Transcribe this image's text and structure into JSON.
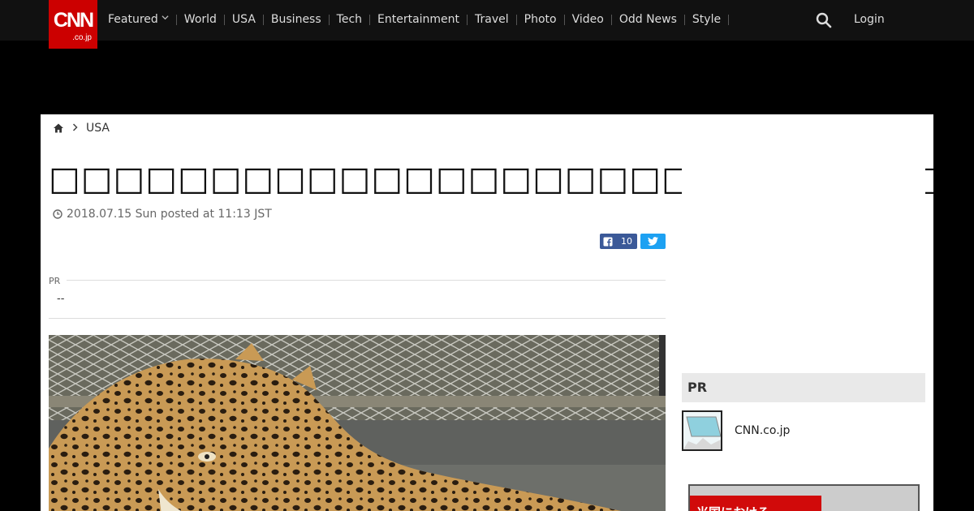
{
  "header": {
    "logo_main": "CNN",
    "logo_sub": ".co.jp",
    "nav": [
      {
        "label": "Featured",
        "has_dropdown": true
      },
      {
        "label": "World"
      },
      {
        "label": "USA"
      },
      {
        "label": "Business"
      },
      {
        "label": "Tech"
      },
      {
        "label": "Entertainment"
      },
      {
        "label": "Travel"
      },
      {
        "label": "Photo"
      },
      {
        "label": "Video"
      },
      {
        "label": "Odd News"
      },
      {
        "label": "Style"
      }
    ],
    "search_icon": "search-icon",
    "login_label": "Login"
  },
  "breadcrumb": {
    "home_icon": "home-icon",
    "section": "USA"
  },
  "article": {
    "title": "□□□□□□□□□□□□□□□□□□□□□□□□□□□□□□□□□",
    "date": "2018.07.15 Sun posted at 11:13 JST",
    "facebook_count": "10"
  },
  "pr": {
    "label": "PR",
    "value": "--"
  },
  "sidebar": {
    "pr_heading": "PR",
    "item_label": "CNN.co.jp",
    "banner_text": "米国における"
  },
  "colors": {
    "brand_red": "#cc0000",
    "facebook_blue": "#3b5998",
    "twitter_blue": "#1da1f2"
  }
}
